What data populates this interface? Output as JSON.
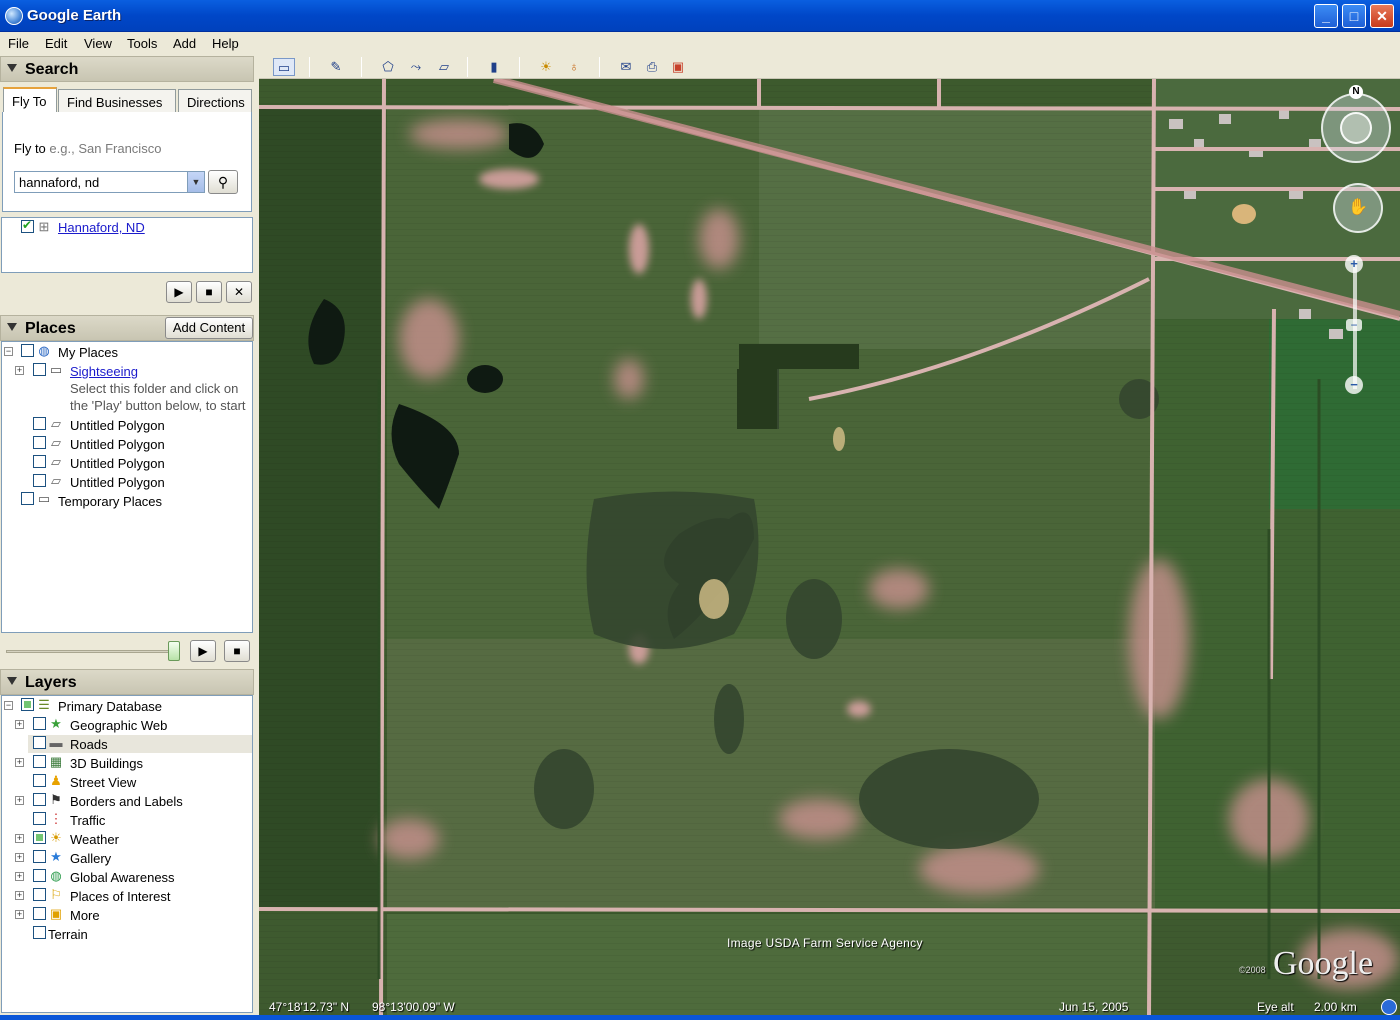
{
  "window": {
    "title": "Google Earth",
    "minimize": "_",
    "maximize": "□",
    "close": "✕"
  },
  "menu": [
    "File",
    "Edit",
    "View",
    "Tools",
    "Add",
    "Help"
  ],
  "search": {
    "header": "Search",
    "tabs": [
      "Fly To",
      "Find Businesses",
      "Directions"
    ],
    "fly_label": "Fly to",
    "fly_hint": "e.g., San Francisco",
    "fly_value": "hannaford, nd",
    "result": "Hannaford, ND"
  },
  "places": {
    "header": "Places",
    "add_content": "Add Content",
    "items": [
      {
        "label": "My Places"
      },
      {
        "label": "Sightseeing"
      },
      {
        "label": "Select this folder and click on"
      },
      {
        "label": "the 'Play' button below, to start"
      },
      {
        "label": "Untitled Polygon"
      },
      {
        "label": "Untitled Polygon"
      },
      {
        "label": "Untitled Polygon"
      },
      {
        "label": "Untitled Polygon"
      },
      {
        "label": "Temporary Places"
      }
    ]
  },
  "layers": {
    "header": "Layers",
    "items": [
      {
        "label": "Primary Database"
      },
      {
        "label": "Geographic Web"
      },
      {
        "label": "Roads"
      },
      {
        "label": "3D Buildings"
      },
      {
        "label": "Street View"
      },
      {
        "label": "Borders and Labels"
      },
      {
        "label": "Traffic"
      },
      {
        "label": "Weather"
      },
      {
        "label": "Gallery"
      },
      {
        "label": "Global Awareness"
      },
      {
        "label": "Places of Interest"
      },
      {
        "label": "More"
      },
      {
        "label": "Terrain"
      }
    ]
  },
  "map": {
    "attribution": "Image USDA Farm Service Agency",
    "copyright": "©2008",
    "brand": "Google",
    "lat": "47°18'12.73\" N",
    "lon": "98°13'00.09\" W",
    "date": "Jun 15, 2005",
    "eye_alt_label": "Eye alt",
    "eye_alt_value": "2.00 km",
    "north": "N",
    "zoom_in": "+",
    "zoom_out": "−"
  },
  "colors": {
    "accent": "#0A56D8",
    "link": "#1b1bcc"
  }
}
